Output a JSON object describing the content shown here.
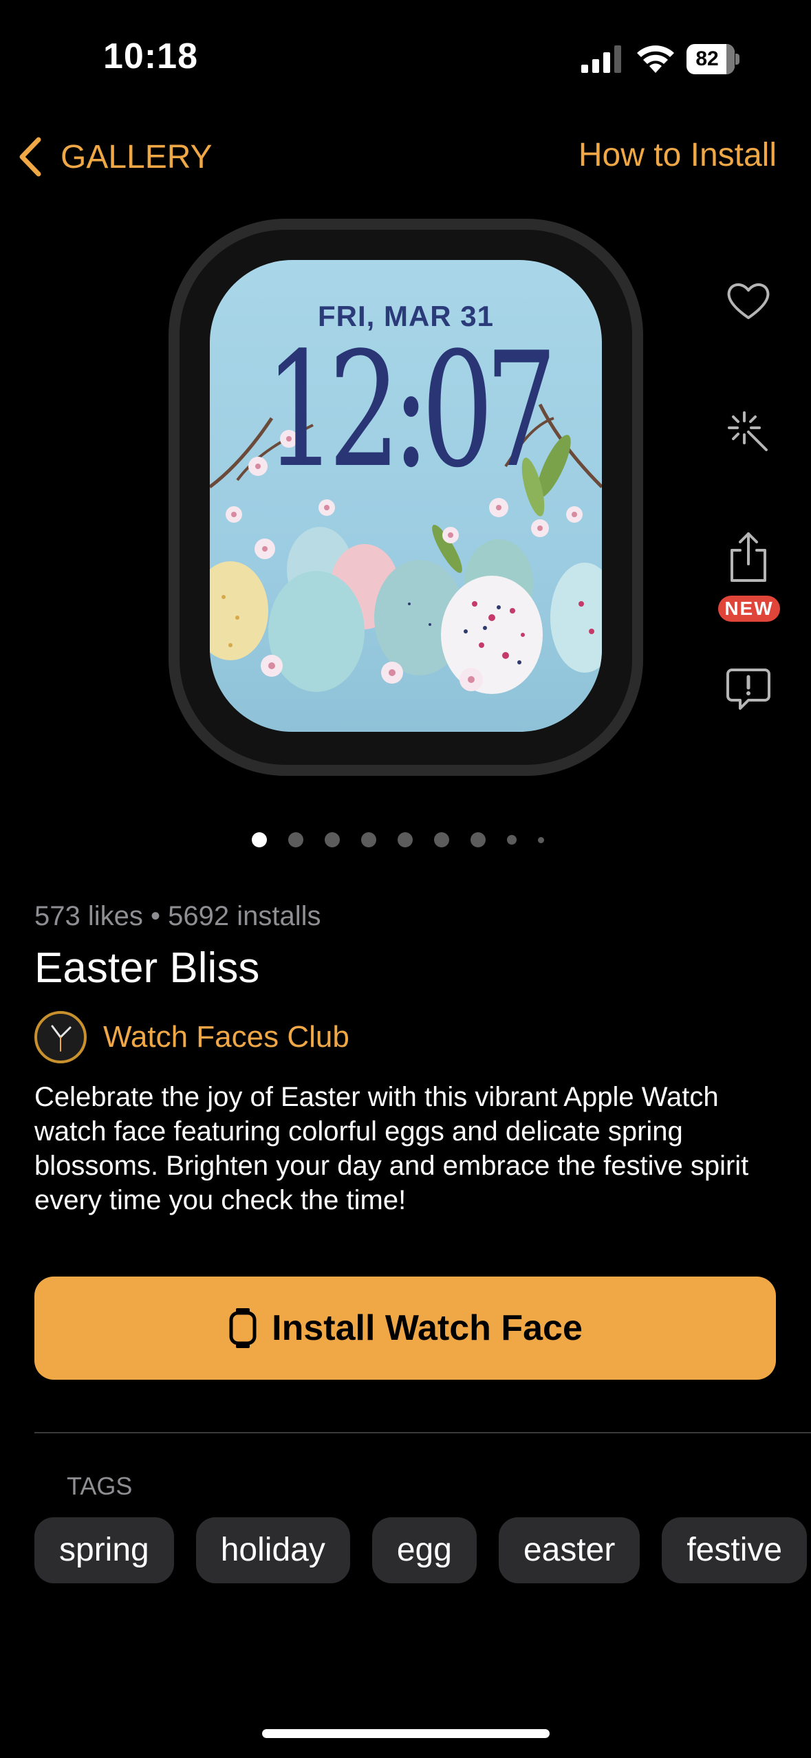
{
  "status": {
    "time": "10:18",
    "battery": "82",
    "icons": [
      "signal-icon",
      "wifi-icon",
      "battery-icon"
    ]
  },
  "nav": {
    "back_label": "GALLERY",
    "howto_label": "How to Install"
  },
  "watch_face": {
    "date": "FRI, MAR 31",
    "time": "12:07"
  },
  "actions": {
    "icons": [
      "heart-icon",
      "sparkle-wand-icon",
      "share-icon",
      "report-icon"
    ],
    "new_badge": "NEW"
  },
  "pager": {
    "count": 9,
    "active_index": 0
  },
  "info": {
    "stats": "573 likes • 5692 installs",
    "title": "Easter Bliss",
    "author": "Watch Faces Club",
    "description": "Celebrate the joy of Easter with this vibrant Apple Watch watch face  featuring colorful eggs and delicate spring blossoms. Brighten your day  and embrace the festive spirit every time you check the time!"
  },
  "install_button": {
    "label": "Install Watch Face"
  },
  "tags": {
    "label": "TAGS",
    "items": [
      "spring",
      "holiday",
      "egg",
      "easter",
      "festive"
    ]
  },
  "colors": {
    "accent": "#f0a847",
    "background": "#000000",
    "tag_bg": "#2c2c2e",
    "badge": "#e0453a"
  }
}
